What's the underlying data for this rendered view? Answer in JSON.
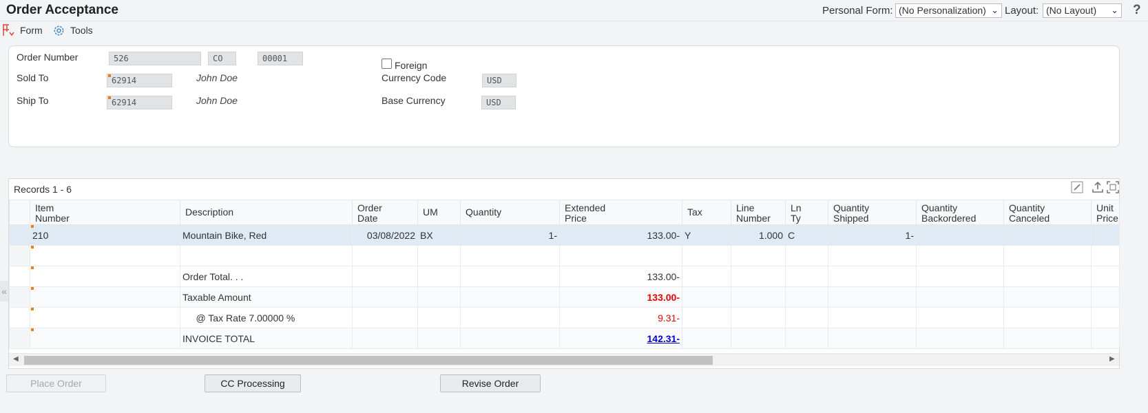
{
  "header": {
    "title": "Order Acceptance",
    "personal_form_label": "Personal Form:",
    "personal_form_value": "(No Personalization)",
    "layout_label": "Layout:",
    "layout_value": "(No Layout)",
    "help": "?"
  },
  "toolbar": {
    "form_label": "Form",
    "tools_label": "Tools"
  },
  "order": {
    "order_number_label": "Order Number",
    "order_number": "526",
    "order_type": "CO",
    "order_company": "00001",
    "sold_to_label": "Sold To",
    "sold_to": "62914",
    "sold_to_name": "John Doe",
    "ship_to_label": "Ship To",
    "ship_to": "62914",
    "ship_to_name": "John Doe",
    "foreign_label": "Foreign",
    "foreign_checked": false,
    "currency_code_label": "Currency Code",
    "currency_code": "USD",
    "base_currency_label": "Base Currency",
    "base_currency": "USD"
  },
  "grid": {
    "records_label": "Records 1 - 6",
    "columns": [
      [
        "Item",
        "Number"
      ],
      [
        "Description",
        ""
      ],
      [
        "Order",
        "Date"
      ],
      [
        "UM",
        ""
      ],
      [
        "Quantity",
        ""
      ],
      [
        "Extended",
        "Price"
      ],
      [
        "Tax",
        ""
      ],
      [
        "Line",
        "Number"
      ],
      [
        "Ln",
        "Ty"
      ],
      [
        "Quantity",
        "Shipped"
      ],
      [
        "Quantity",
        "Backordered"
      ],
      [
        "Quantity",
        "Canceled"
      ],
      [
        "Unit",
        "Price"
      ]
    ],
    "rows": [
      [
        "210",
        "Mountain Bike, Red",
        "03/08/2022",
        "BX",
        "1-",
        "133.00-",
        "Y",
        "1.000",
        "C",
        "1-",
        "",
        "",
        ""
      ],
      [
        "",
        "",
        "",
        "",
        "",
        "",
        "",
        "",
        "",
        "",
        "",
        "",
        ""
      ],
      [
        "",
        "Order Total. . .",
        "",
        "",
        "",
        "133.00-",
        "",
        "",
        "",
        "",
        "",
        "",
        ""
      ],
      [
        "",
        "Taxable Amount",
        "",
        "",
        "",
        "133.00-",
        "",
        "",
        "",
        "",
        "",
        "",
        ""
      ],
      [
        "",
        "     @ Tax Rate 7.00000 %",
        "",
        "",
        "",
        "9.31-",
        "",
        "",
        "",
        "",
        "",
        "",
        ""
      ],
      [
        "",
        "INVOICE TOTAL",
        "",
        "",
        "",
        "142.31-",
        "",
        "",
        "",
        "",
        "",
        "",
        ""
      ]
    ]
  },
  "buttons": {
    "place_order": "Place Order",
    "cc_processing": "CC Processing",
    "revise_order": "Revise Order"
  },
  "colors": {
    "flag": "#e67e22",
    "selected_row": "#dfeaf4",
    "negative_red": "#e60000",
    "link_blue": "#0000cc"
  }
}
